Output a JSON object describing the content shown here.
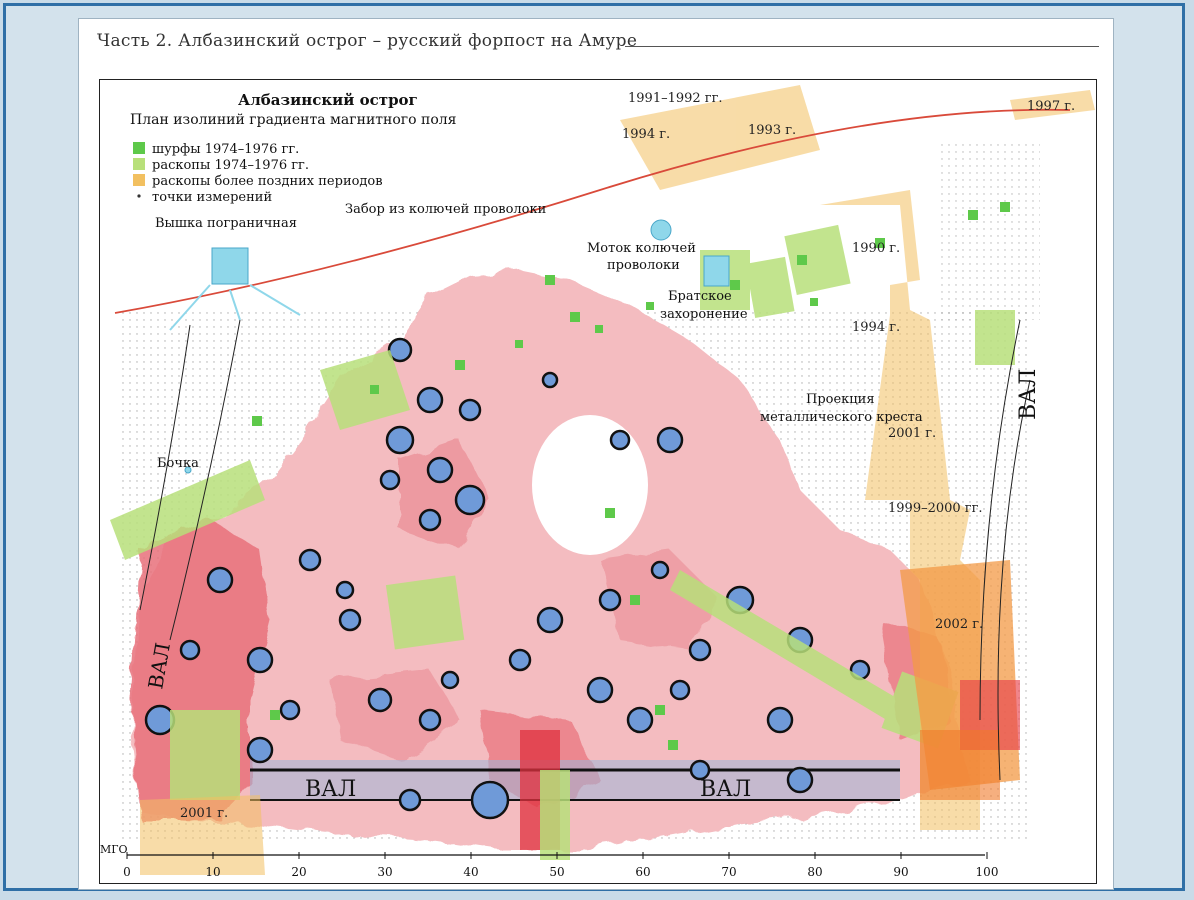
{
  "header": {
    "running_title": "Часть 2. Албазинский острог – русский форпост на Амуре"
  },
  "map": {
    "title": "Албазинский острог",
    "subtitle": "План изолиний градиента магнитного поля",
    "legend": [
      {
        "label": "шурфы 1974–1976 гг.",
        "color": "#5ec94a",
        "kind": "square"
      },
      {
        "label": "раскопы 1974–1976 гг.",
        "color": "#b8e07a",
        "kind": "square"
      },
      {
        "label": "раскопы более поздних периодов",
        "color": "#f2c060",
        "kind": "square"
      },
      {
        "label": "точки измерений",
        "color": "#333333",
        "kind": "dot"
      }
    ],
    "labels": {
      "border_tower": "Вышка пограничная",
      "fence": "Забор из колючей проволоки",
      "wire_coil": "Моток колючей",
      "wire_coil_2": "проволоки",
      "grave": "Братское",
      "grave_2": "захоронение",
      "cross": "Проекция",
      "cross_2": "металлического креста",
      "barrel": "Бочка",
      "val_right": "ВАЛ",
      "val_left": "ВАЛ",
      "val_bottom_a": "ВАЛ",
      "val_bottom_b": "ВАЛ",
      "mgo": "МГО"
    },
    "years": {
      "y1991_1992": "1991–1992 гг.",
      "y1994_top": "1994 г.",
      "y1993": "1993 г.",
      "y1997": "1997 г.",
      "y1990": "1990 г.",
      "y1994_right": "1994 г.",
      "y2001_right": "2001 г.",
      "y1999_2000": "1999–2000 гг.",
      "y2002": "2002 г.",
      "y2001_left": "2001 г."
    },
    "x_axis_ticks": [
      "0",
      "10",
      "20",
      "30",
      "40",
      "50",
      "60",
      "70",
      "80",
      "90",
      "100"
    ]
  },
  "colors": {
    "frame": "#2f6fa6",
    "map_pink": "#f4bcc0",
    "map_red": "#e8707a",
    "anomaly_blue": "#6f9ad8",
    "excavation_green": "#b8e07a",
    "pit_green": "#5ec94a",
    "late_excavation": "#f2c060",
    "orange_2002": "#f39a45",
    "fence_red": "#d94a3a"
  }
}
